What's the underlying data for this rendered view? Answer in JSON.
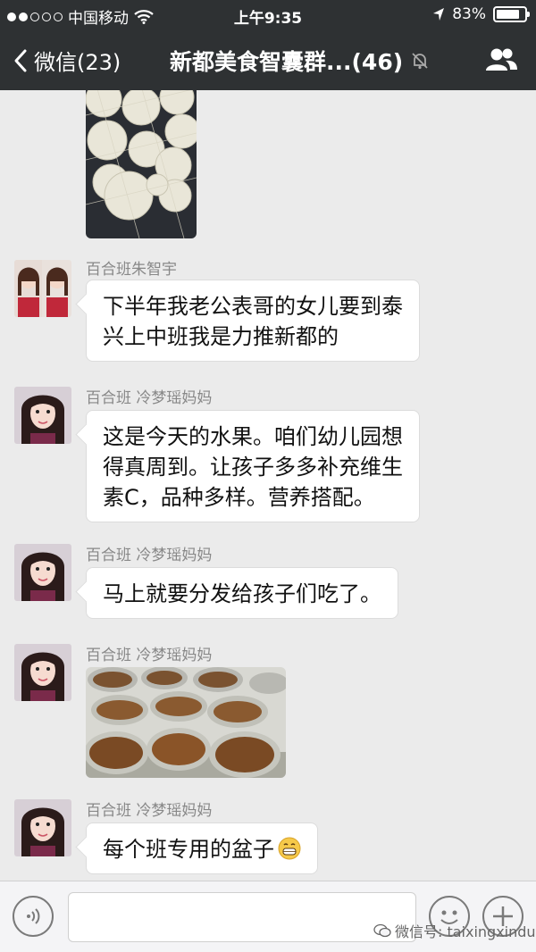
{
  "status_bar": {
    "carrier": "中国移动",
    "time": "上午9:35",
    "battery_percent": 83,
    "battery_label": "83%"
  },
  "nav": {
    "back_label": "微信(23)",
    "title": "新都美食智囊群...(46)"
  },
  "messages": [
    {
      "type": "image",
      "subject": "pears in foam nets"
    },
    {
      "type": "text",
      "sender": "百合班朱智宇",
      "lines": [
        "下半年我老公表哥的女儿要到泰",
        "兴上中班我是力推新都的"
      ]
    },
    {
      "type": "text",
      "sender": "百合班 冷梦瑶妈妈",
      "lines": [
        "这是今天的水果。咱们幼儿园想",
        "得真周到。让孩子多多补充维生",
        "素C，品种多样。营养搭配。"
      ]
    },
    {
      "type": "text",
      "sender": "百合班 冷梦瑶妈妈",
      "lines": [
        "马上就要分发给孩子们吃了。"
      ]
    },
    {
      "type": "image",
      "sender": "百合班 冷梦瑶妈妈",
      "subject": "bowls of longan"
    },
    {
      "type": "text",
      "sender": "百合班 冷梦瑶妈妈",
      "lines": [
        "每个班专用的盆子"
      ],
      "emoji": "grin-icon"
    }
  ],
  "watermark": "微信号: taixingxindu",
  "colors": {
    "topbar": "#2e3133",
    "chat_bg": "#ebebeb",
    "bubble": "#ffffff"
  }
}
